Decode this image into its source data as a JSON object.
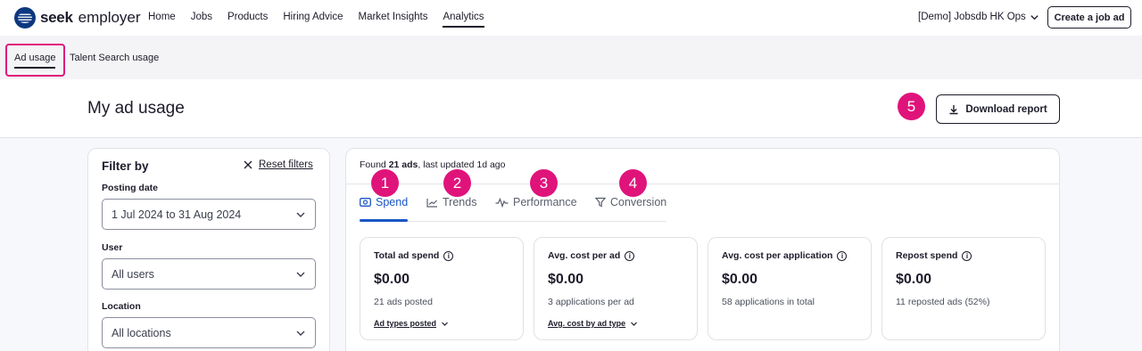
{
  "nav": {
    "logo_seek": "seek",
    "logo_employer": "employer",
    "links": [
      "Home",
      "Jobs",
      "Products",
      "Hiring Advice",
      "Market Insights",
      "Analytics"
    ],
    "account": "[Demo] Jobsdb HK Ops",
    "create_button": "Create a job ad"
  },
  "subnav": {
    "tabs": [
      "Ad usage",
      "Talent Search usage"
    ]
  },
  "header": {
    "title": "My ad usage",
    "download_button": "Download report"
  },
  "markers": [
    "1",
    "2",
    "3",
    "4",
    "5"
  ],
  "filters": {
    "title": "Filter by",
    "reset": "Reset filters",
    "posting_date_label": "Posting date",
    "posting_date_value": "1 Jul 2024 to 31 Aug 2024",
    "user_label": "User",
    "user_value": "All users",
    "location_label": "Location",
    "location_value": "All locations"
  },
  "summary": {
    "found_prefix": "Found ",
    "found_count": "21 ads",
    "found_suffix": ", last updated 1d ago"
  },
  "tabs": [
    "Spend",
    "Trends",
    "Performance",
    "Conversion"
  ],
  "cards": [
    {
      "title": "Total ad spend",
      "value": "$0.00",
      "sub": "21 ads posted",
      "link": "Ad types posted"
    },
    {
      "title": "Avg. cost per ad",
      "value": "$0.00",
      "sub": "3 applications per ad",
      "link": "Avg. cost by ad type"
    },
    {
      "title": "Avg. cost per application",
      "value": "$0.00",
      "sub": "58 applications in total",
      "link": ""
    },
    {
      "title": "Repost spend",
      "value": "$0.00",
      "sub": "11 reposted ads (52%)",
      "link": ""
    }
  ],
  "colors": {
    "accent": "#1a56c4",
    "marker": "#e0137b",
    "brand": "#0d3880"
  }
}
